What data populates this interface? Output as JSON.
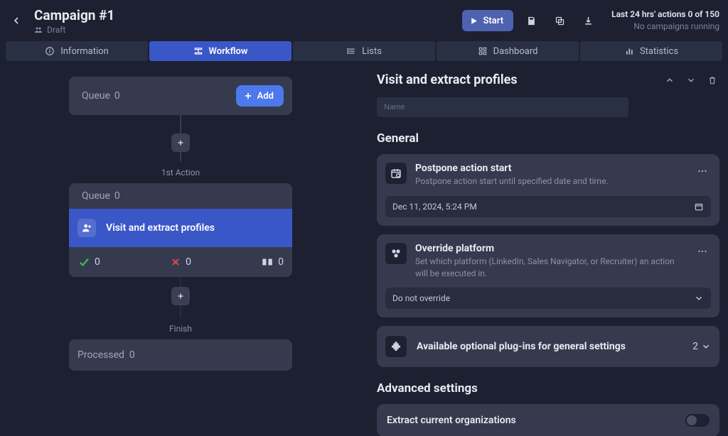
{
  "header": {
    "campaign_title": "Campaign #1",
    "status": "Draft",
    "start_label": "Start",
    "actions_text": "Last 24 hrs' actions 0 of 150",
    "running_text": "No campaigns running"
  },
  "tabs": {
    "info": "Information",
    "workflow": "Workflow",
    "lists": "Lists",
    "dashboard": "Dashboard",
    "statistics": "Statistics"
  },
  "workflow": {
    "queue_label": "Queue",
    "queue_count": "0",
    "add_label": "Add",
    "first_action": "1st Action",
    "action_queue_label": "Queue",
    "action_queue_count": "0",
    "action_title": "Visit and extract profiles",
    "success_count": "0",
    "fail_count": "0",
    "process_count": "0",
    "finish_label": "Finish",
    "processed_label": "Processed",
    "processed_count": "0"
  },
  "panel": {
    "title": "Visit and extract profiles",
    "name_placeholder": "Name",
    "general_heading": "General",
    "postpone": {
      "title": "Postpone action start",
      "desc": "Postpone action start until specified date and time.",
      "value": "Dec 11, 2024, 5:24 PM"
    },
    "override": {
      "title": "Override platform",
      "desc": "Set which platform (LinkedIn, Sales Navigator, or Recruiter) an action will be executed in.",
      "value": "Do not override"
    },
    "plugins": {
      "title": "Available optional plug-ins for general settings",
      "count": "2"
    },
    "advanced_heading": "Advanced settings",
    "extract_org": "Extract current organizations"
  }
}
